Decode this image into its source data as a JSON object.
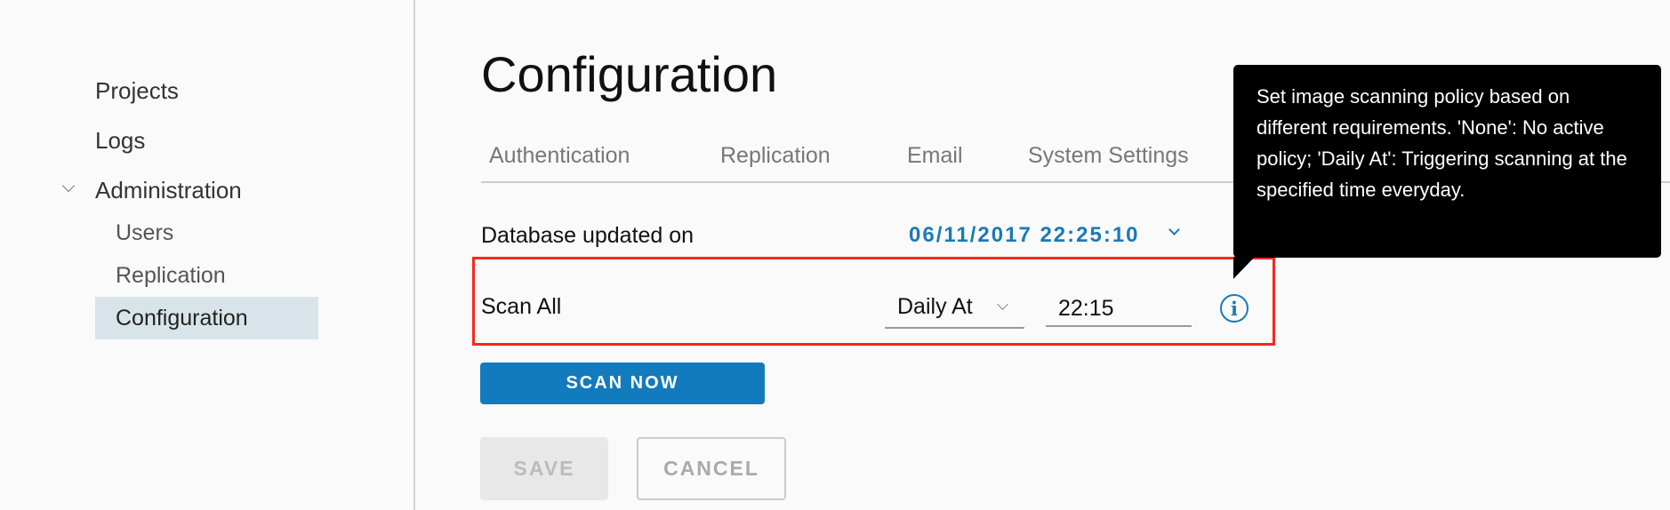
{
  "sidebar": {
    "items": [
      {
        "label": "Projects"
      },
      {
        "label": "Logs"
      },
      {
        "label": "Administration",
        "expanded": true,
        "children": [
          {
            "label": "Users"
          },
          {
            "label": "Replication"
          },
          {
            "label": "Configuration",
            "active": true
          }
        ]
      }
    ]
  },
  "main": {
    "title": "Configuration",
    "tabs": [
      {
        "label": "Authentication"
      },
      {
        "label": "Replication"
      },
      {
        "label": "Email"
      },
      {
        "label": "System Settings"
      }
    ],
    "database_label": "Database updated on",
    "database_value": "06/11/2017 22:25:10",
    "scan_all_label": "Scan All",
    "policy_select": "Daily At",
    "time_value": "22:15",
    "info_icon": "info-circle-icon",
    "tooltip": "Set image scanning policy based on different requirements. 'None': No active policy; 'Daily At': Triggering scanning at the specified time everyday.",
    "scan_now_label": "SCAN NOW",
    "save_label": "SAVE",
    "cancel_label": "CANCEL"
  },
  "colors": {
    "accent": "#127bbd",
    "highlight_box": "#f7291e",
    "active_nav": "#d9e4ea",
    "tooltip_bg": "#000000"
  }
}
